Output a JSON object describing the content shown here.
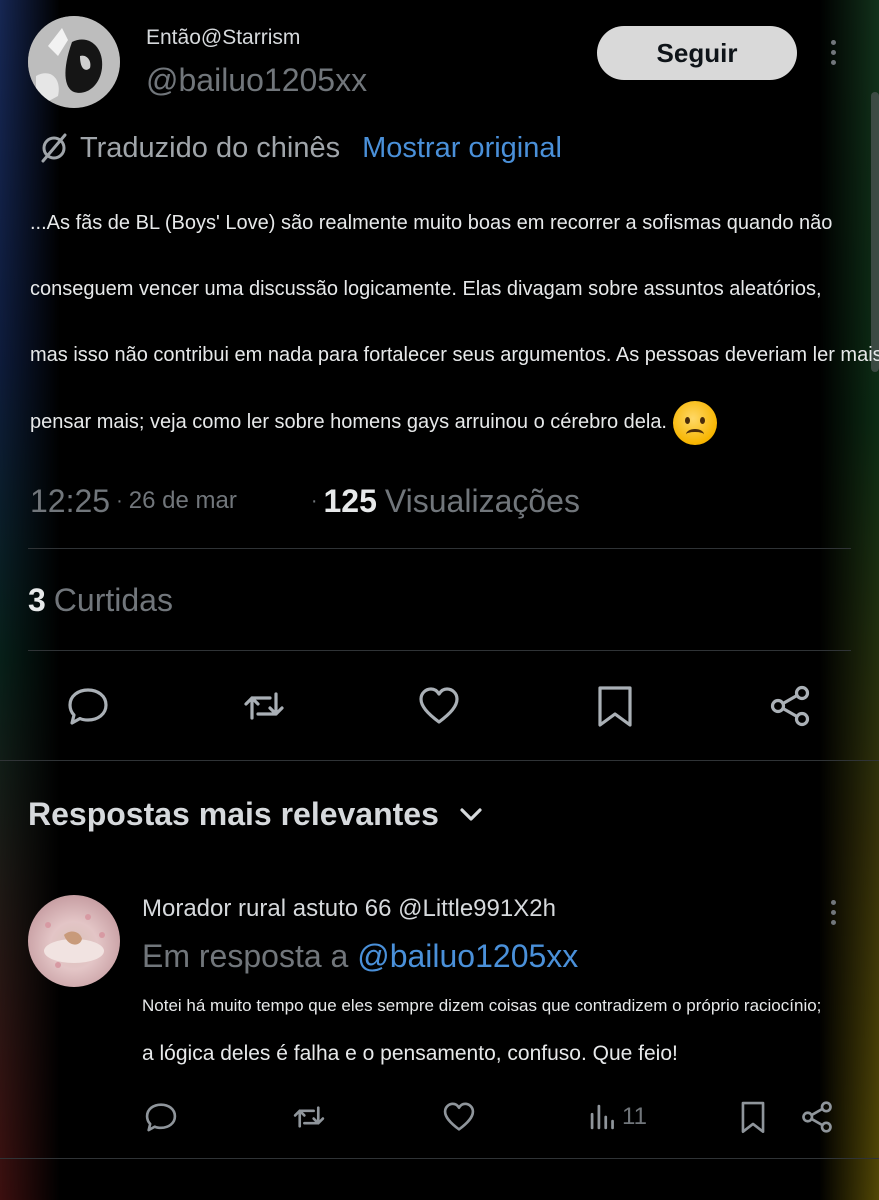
{
  "tweet": {
    "display_name": "Então@Starrism",
    "handle": "@bailuo1205xx",
    "follow_label": "Seguir",
    "translated_label": "Traduzido do chinês",
    "show_original_label": "Mostrar original",
    "body_lines": [
      "...As fãs de BL (Boys' Love) são realmente muito boas em recorrer a sofismas quando não",
      "conseguem vencer uma discussão logicamente. Elas divagam sobre assuntos aleatórios,",
      "mas isso não contribui em nada para fortalecer seus argumentos. As pessoas deveriam ler mais e",
      "pensar mais; veja como ler sobre homens gays arruinou o cérebro dela."
    ],
    "emoji": "sad-tear-face",
    "time": "12:25",
    "date": "26 de mar",
    "views_count": "125",
    "views_label": "Visualizações",
    "likes_count": "3",
    "likes_label": "Curtidas"
  },
  "actions": [
    "reply-icon",
    "retweet-icon",
    "like-icon",
    "bookmark-icon",
    "share-icon"
  ],
  "replies_header": "Respostas mais relevantes",
  "reply": {
    "author": "Morador rural astuto 66 @Little991X2h",
    "in_reply_prefix": "Em resposta a",
    "in_reply_handle": "@bailuo1205xx",
    "lines": [
      "Notei há muito tempo que eles sempre dizem coisas que contradizem o próprio raciocínio;",
      "a lógica deles é falha e o pensamento, confuso. Que feio!"
    ],
    "views_count": "11"
  },
  "colors": {
    "background": "#000000",
    "text": "#e7e9ea",
    "muted": "#71767b",
    "link": "#4a90d9",
    "follow_button": "#d9d9d9"
  }
}
